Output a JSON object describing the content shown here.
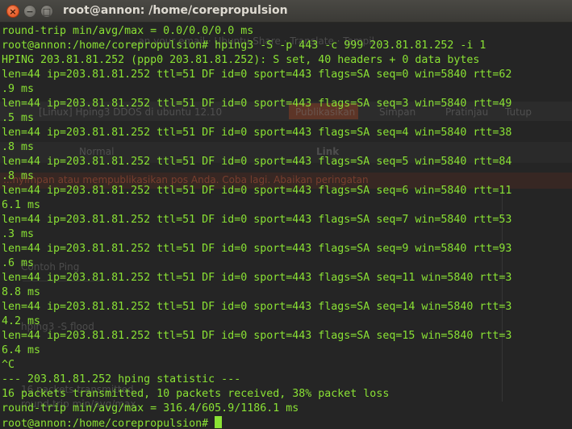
{
  "window": {
    "title": "root@annon: /home/corepropulsion",
    "buttons": {
      "close": "×",
      "minimize": "−",
      "maximize": "□"
    }
  },
  "background_window": {
    "tab_label": "[Linux] Hping3 DDOS di ubuntu 12.10",
    "buttons": [
      "Publikasikan",
      "Simpan",
      "Pratinjau",
      "Tutup"
    ],
    "font_select": "Normal",
    "link_button": "Link",
    "error_message": "...nyimpan atau mempublikasikan pos Anda. Coba lagi. Abaikan peringatan",
    "header_text": "...an your email · Ubuntu Share · Translate · Tampil",
    "fragments": [
      "16 packets transmitted",
      "round-trip min/avg/max",
      "Contoh Ping",
      "hping3 -S flood"
    ]
  },
  "terminal": {
    "lines": [
      "round-trip min/avg/max = 0.0/0.0/0.0 ms",
      "root@annon:/home/corepropulsion# hping3 -S -p 443 -c 999 203.81.81.252 -i 1",
      "HPING 203.81.81.252 (ppp0 203.81.81.252): S set, 40 headers + 0 data bytes",
      "len=44 ip=203.81.81.252 ttl=51 DF id=0 sport=443 flags=SA seq=0 win=5840 rtt=62",
      ".9 ms",
      "len=44 ip=203.81.81.252 ttl=51 DF id=0 sport=443 flags=SA seq=3 win=5840 rtt=49",
      ".5 ms",
      "len=44 ip=203.81.81.252 ttl=51 DF id=0 sport=443 flags=SA seq=4 win=5840 rtt=38",
      ".8 ms",
      "len=44 ip=203.81.81.252 ttl=51 DF id=0 sport=443 flags=SA seq=5 win=5840 rtt=84",
      ".8 ms",
      "len=44 ip=203.81.81.252 ttl=51 DF id=0 sport=443 flags=SA seq=6 win=5840 rtt=11",
      "6.1 ms",
      "len=44 ip=203.81.81.252 ttl=51 DF id=0 sport=443 flags=SA seq=7 win=5840 rtt=53",
      ".3 ms",
      "len=44 ip=203.81.81.252 ttl=51 DF id=0 sport=443 flags=SA seq=9 win=5840 rtt=93",
      ".6 ms",
      "len=44 ip=203.81.81.252 ttl=51 DF id=0 sport=443 flags=SA seq=11 win=5840 rtt=3",
      "8.8 ms",
      "len=44 ip=203.81.81.252 ttl=51 DF id=0 sport=443 flags=SA seq=14 win=5840 rtt=3",
      "4.2 ms",
      "len=44 ip=203.81.81.252 ttl=51 DF id=0 sport=443 flags=SA seq=15 win=5840 rtt=3",
      "6.4 ms",
      "^C",
      "--- 203.81.81.252 hping statistic ---",
      "16 packets transmitted, 10 packets received, 38% packet loss",
      "round-trip min/avg/max = 316.4/605.9/1186.1 ms"
    ],
    "prompt": "root@annon:/home/corepropulsion# ",
    "text_color": "#8ae234",
    "background_color": "#252525"
  }
}
